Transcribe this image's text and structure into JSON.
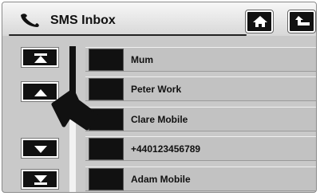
{
  "header": {
    "title": "SMS Inbox",
    "icons": {
      "phone": "phone-icon",
      "home": "home-icon",
      "back": "back-arrow-icon"
    }
  },
  "navigation": {
    "icons": [
      "skip-top-icon",
      "arrow-up-icon",
      "arrow-down-icon",
      "skip-bottom-icon"
    ]
  },
  "inbox": {
    "items": [
      {
        "label": "Mum"
      },
      {
        "label": "Peter Work"
      },
      {
        "label": "Clare Mobile"
      },
      {
        "label": "+440123456789"
      },
      {
        "label": "Adam Mobile"
      }
    ]
  },
  "colors": {
    "panel": "#c9c9c9",
    "row": "#c2c2c2",
    "button": "#111111",
    "accent": "#ffffff"
  }
}
